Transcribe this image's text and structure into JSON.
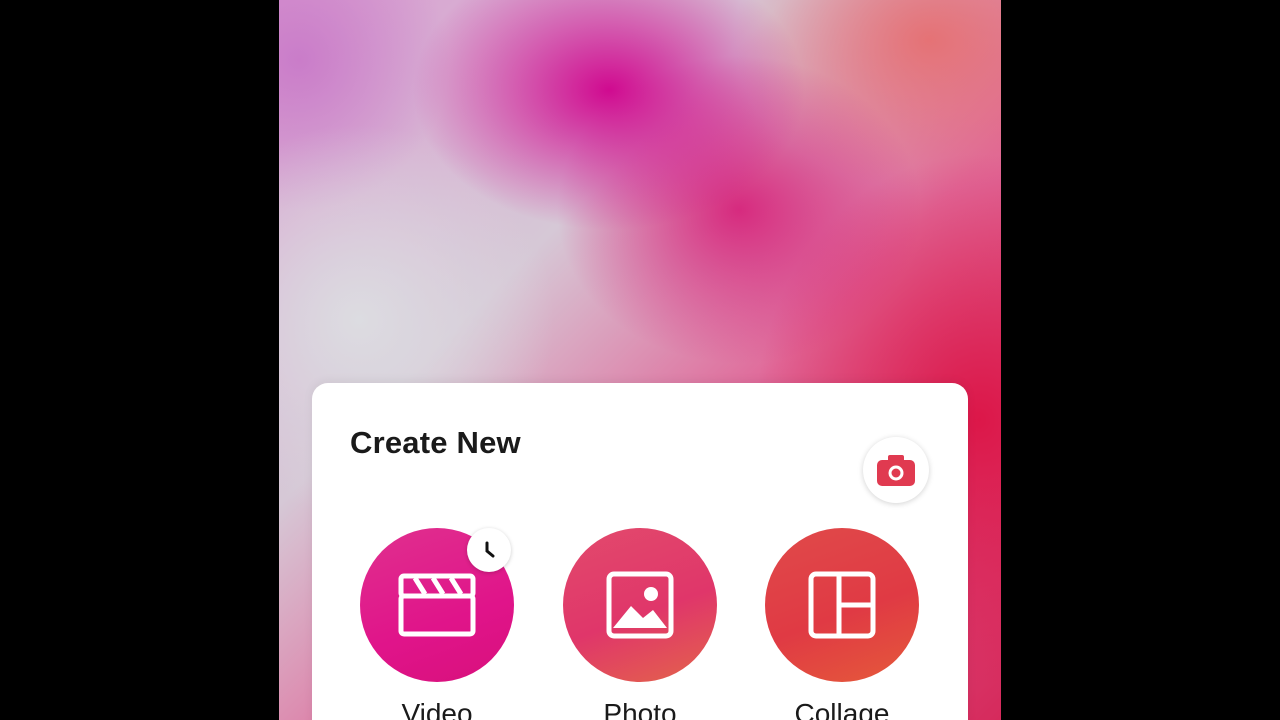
{
  "create_new": {
    "title": "Create New",
    "camera": {
      "icon": "camera-icon",
      "color": "#e03a50"
    },
    "options": [
      {
        "label": "Video",
        "icon": "video-clapperboard-icon",
        "badge_icon": "clock-icon"
      },
      {
        "label": "Photo",
        "icon": "image-icon"
      },
      {
        "label": "Collage",
        "icon": "collage-layout-icon"
      }
    ]
  },
  "colors": {
    "video": "#e0148a",
    "photo": "#e0366a",
    "collage": "#e03a44"
  }
}
